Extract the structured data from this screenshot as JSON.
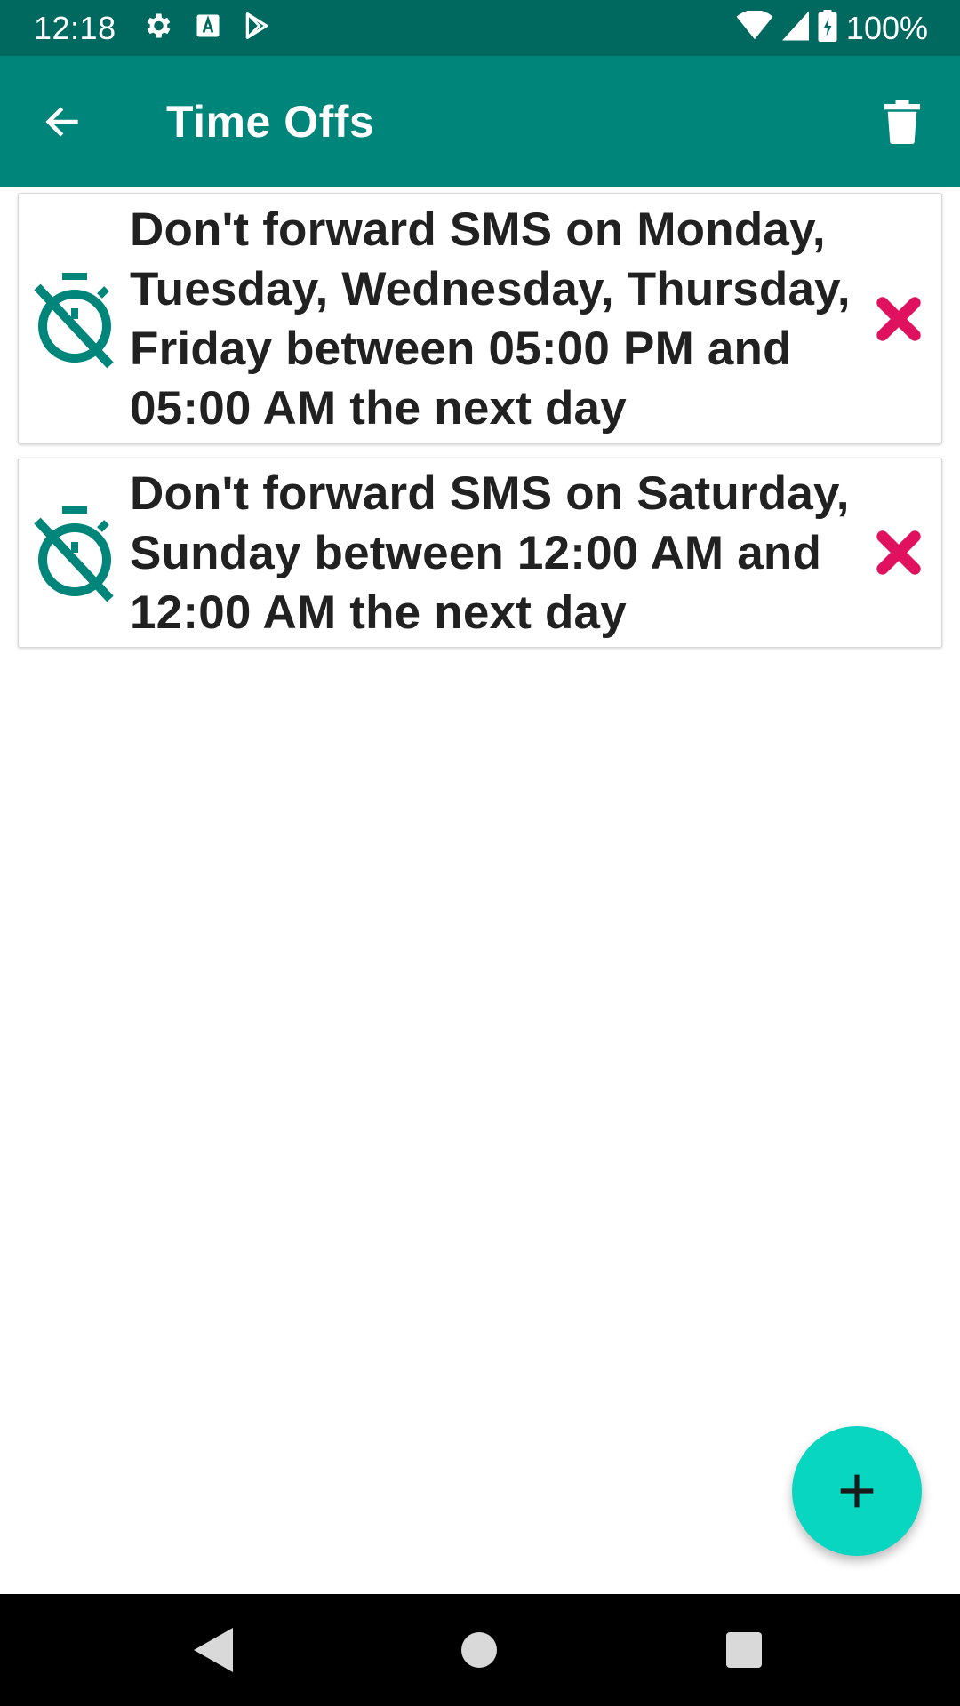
{
  "status_bar": {
    "time": "12:18",
    "left_icons": [
      "settings-icon",
      "font-a-icon",
      "play-store-icon"
    ],
    "right_icons": [
      "wifi-icon",
      "cell-signal-icon",
      "battery-charging-icon"
    ],
    "battery": "100%"
  },
  "app_bar": {
    "title": "Time Offs",
    "back_icon": "arrow-back-icon",
    "action_icon": "trash-icon",
    "background": "#00857a"
  },
  "time_offs": [
    {
      "icon": "timer-off-icon",
      "text": "Don't forward SMS on Monday, Tuesday, Wednesday, Thursday, Friday between 05:00 PM and 05:00 AM the next day",
      "delete_icon": "close-x-icon"
    },
    {
      "icon": "timer-off-icon",
      "text": "Don't forward SMS on Saturday, Sunday between 12:00 AM and 12:00 AM the next day",
      "delete_icon": "close-x-icon"
    }
  ],
  "fab": {
    "icon": "plus-icon",
    "color": "#08d6c1"
  },
  "nav_bar": {
    "icons": [
      "nav-back-icon",
      "nav-home-icon",
      "nav-recents-icon"
    ]
  },
  "colors": {
    "status_bar": "#00695f",
    "accent_teal": "#00857a",
    "delete_red": "#e0115f",
    "fab": "#08d6c1"
  }
}
